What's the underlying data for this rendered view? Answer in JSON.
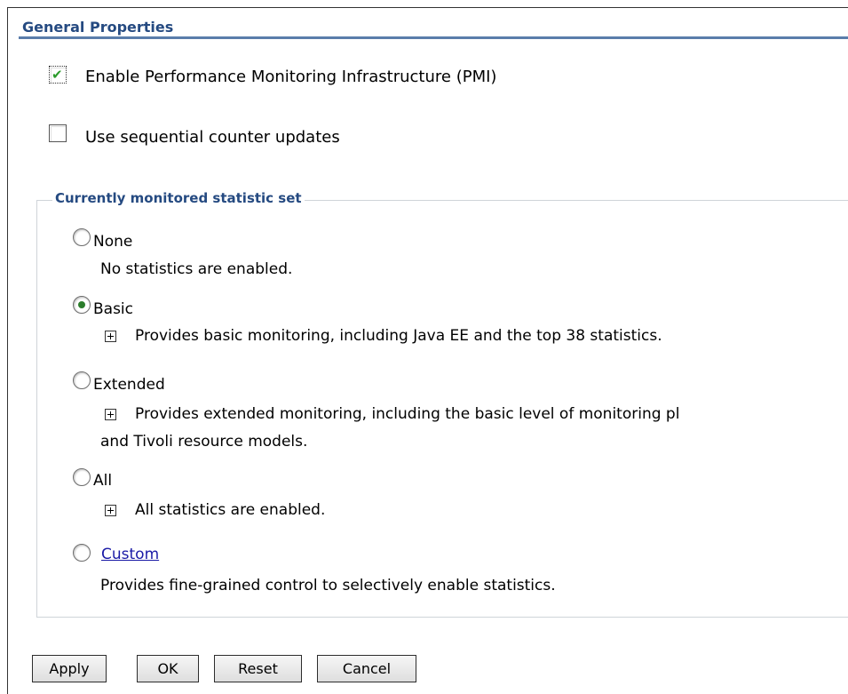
{
  "section": {
    "title": "General Properties"
  },
  "options": {
    "enable_pmi": {
      "label": "Enable Performance Monitoring Infrastructure (PMI)",
      "checked": true
    },
    "sequential_updates": {
      "label": "Use sequential counter updates",
      "checked": false
    }
  },
  "statistic_set": {
    "legend": "Currently monitored statistic set",
    "selected": "Basic",
    "items": [
      {
        "label": "None",
        "description": "No statistics are enabled."
      },
      {
        "label": "Basic",
        "description": "Provides basic monitoring, including Java EE and the top 38 statistics."
      },
      {
        "label": "Extended",
        "description_line1": "Provides extended monitoring, including the basic level of monitoring pl",
        "description_line2": "and Tivoli resource models."
      },
      {
        "label": "All",
        "description": "All statistics are enabled."
      },
      {
        "label": "Custom",
        "description": "Provides fine-grained control to selectively enable statistics."
      }
    ]
  },
  "buttons": {
    "apply": "Apply",
    "ok": "OK",
    "reset": "Reset",
    "cancel": "Cancel"
  }
}
